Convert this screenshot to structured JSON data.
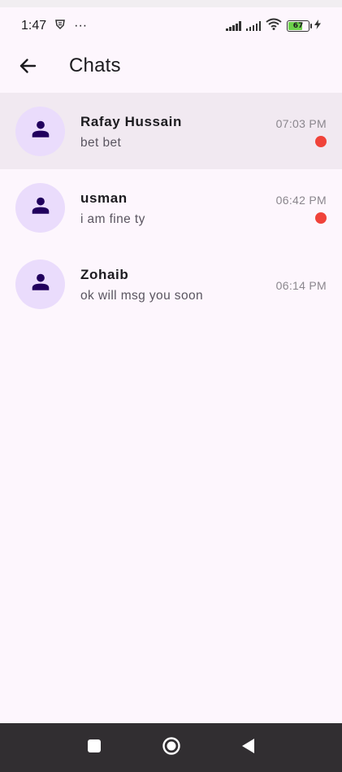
{
  "status_bar": {
    "time": "1:47",
    "dots": "···",
    "battery_level": "67",
    "battery_fill_fraction": 0.67
  },
  "app_bar": {
    "title": "Chats",
    "back_icon": "arrow-back-icon"
  },
  "chats": [
    {
      "name": "Rafay Hussain",
      "last_message": "bet bet",
      "time": "07:03 PM",
      "unread": true,
      "selected": true
    },
    {
      "name": "usman",
      "last_message": "i am fine ty",
      "time": "06:42 PM",
      "unread": true,
      "selected": false
    },
    {
      "name": "Zohaib",
      "last_message": "ok will msg you soon",
      "time": "06:14 PM",
      "unread": false,
      "selected": false
    }
  ],
  "colors": {
    "background": "#fdf6fd",
    "selected_row": "#f1e9f1",
    "avatar_bg": "#eadcfc",
    "avatar_icon": "#21005d",
    "unread_dot": "#f0433a",
    "nav_bar": "#312e31"
  },
  "nav_bar": {
    "icons": [
      "recents-square-icon",
      "home-circle-icon",
      "back-triangle-icon"
    ]
  }
}
